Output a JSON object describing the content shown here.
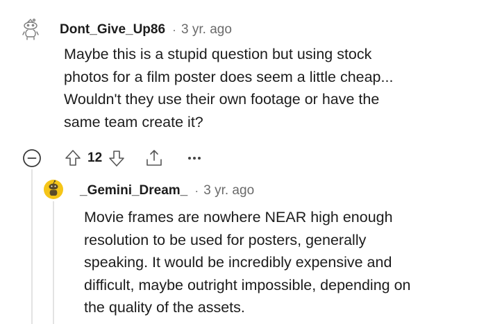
{
  "comments": [
    {
      "username": "Dont_Give_Up86",
      "separator": "·",
      "time": "3 yr. ago",
      "body_lines": [
        "Maybe this is a stupid question but using stock",
        "photos for a film poster does seem a little cheap...",
        "Wouldn't they use their own footage or have the",
        "same team create it?"
      ],
      "avatar_icon": "snoo-outline-icon",
      "votes": "12"
    },
    {
      "username": "_Gemini_Dream_",
      "separator": "·",
      "time": "3 yr. ago",
      "body_lines": [
        "Movie frames are nowhere NEAR high enough",
        "resolution to be used for posters, generally",
        "speaking. It would be incredibly expensive and",
        "difficult, maybe outright impossible, depending on",
        "the quality of the assets."
      ],
      "avatar_icon": "snoo-yellow-icon",
      "avatar_color": "#f5c518"
    }
  ],
  "actions": {
    "collapse_icon": "collapse-minus-icon",
    "upvote_icon": "upvote-arrow-icon",
    "downvote_icon": "downvote-arrow-icon",
    "share_icon": "share-icon",
    "more_icon": "more-options-icon"
  }
}
